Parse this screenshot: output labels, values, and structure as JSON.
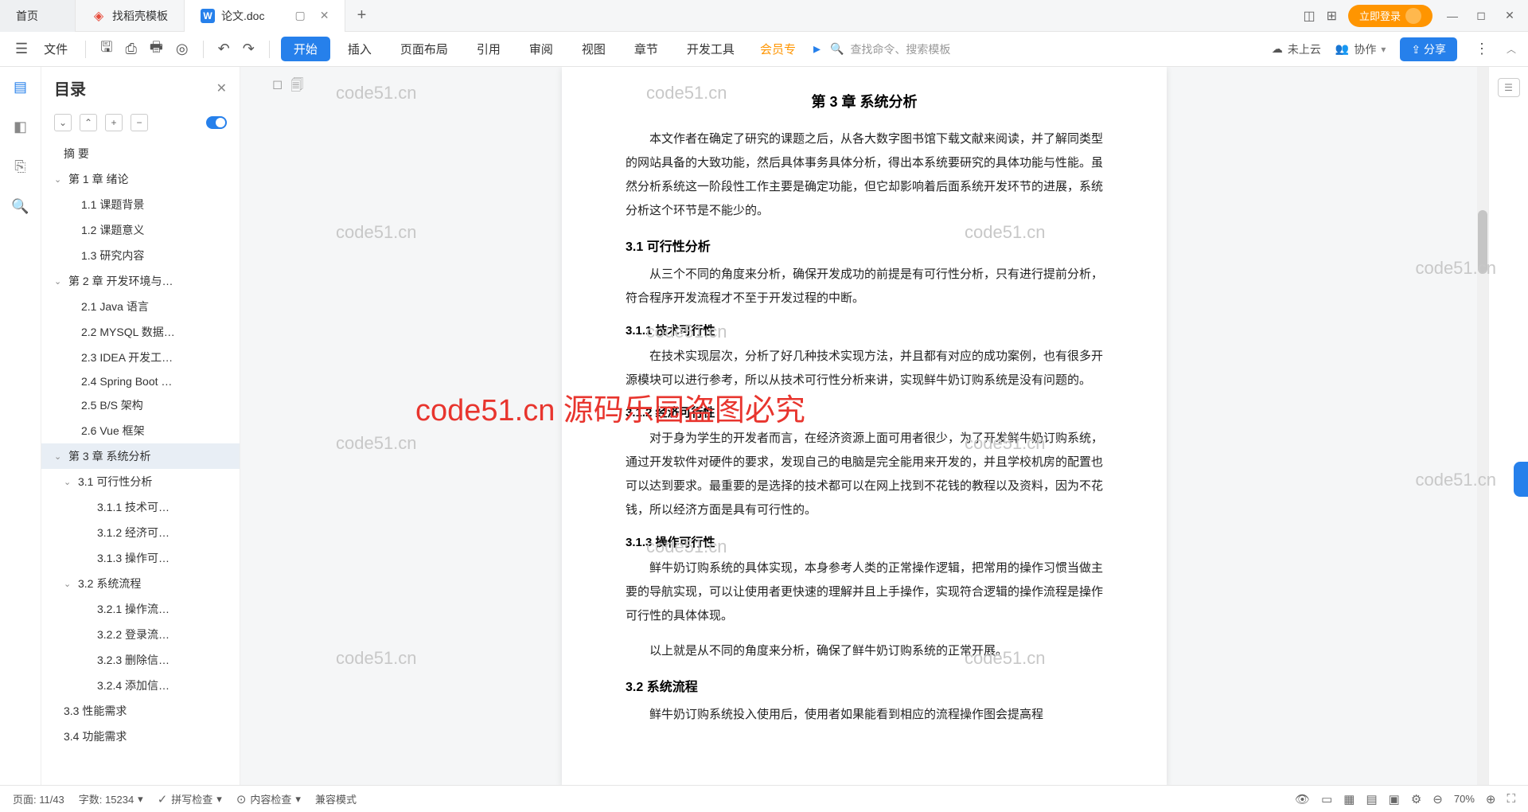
{
  "tabs": {
    "home": "首页",
    "template": "找稻壳模板",
    "doc": "论文.doc"
  },
  "login": "立即登录",
  "file_menu": "文件",
  "menu": [
    "开始",
    "插入",
    "页面布局",
    "引用",
    "审阅",
    "视图",
    "章节",
    "开发工具"
  ],
  "vip": "会员专",
  "search_placeholder": "查找命令、搜索模板",
  "cloud": "未上云",
  "collab": "协作",
  "share": "分享",
  "toc_title": "目录",
  "toc": [
    {
      "lv": 1,
      "t": "摘  要"
    },
    {
      "lv": 0,
      "t": "第 1 章  绪论",
      "a": 1
    },
    {
      "lv": 2,
      "t": "1.1 课题背景"
    },
    {
      "lv": 2,
      "t": "1.2 课题意义"
    },
    {
      "lv": 2,
      "t": "1.3 研究内容"
    },
    {
      "lv": 0,
      "t": "第 2 章  开发环境与…",
      "a": 1
    },
    {
      "lv": 2,
      "t": "2.1 Java 语言"
    },
    {
      "lv": 2,
      "t": "2.2 MYSQL 数据…"
    },
    {
      "lv": 2,
      "t": "2.3 IDEA 开发工…"
    },
    {
      "lv": 2,
      "t": "2.4 Spring Boot …"
    },
    {
      "lv": 2,
      "t": "2.5 B/S 架构"
    },
    {
      "lv": 2,
      "t": "2.6 Vue 框架"
    },
    {
      "lv": 0,
      "t": "第 3 章  系统分析",
      "a": 1,
      "sel": 1
    },
    {
      "lv": 1,
      "t": "3.1  可行性分析",
      "a": 1
    },
    {
      "lv": 3,
      "t": "3.1.1  技术可…"
    },
    {
      "lv": 3,
      "t": "3.1.2  经济可…"
    },
    {
      "lv": 3,
      "t": "3.1.3  操作可…"
    },
    {
      "lv": 1,
      "t": "3.2  系统流程",
      "a": 1
    },
    {
      "lv": 3,
      "t": "3.2.1  操作流…"
    },
    {
      "lv": 3,
      "t": "3.2.2  登录流…"
    },
    {
      "lv": 3,
      "t": "3.2.3  删除信…"
    },
    {
      "lv": 3,
      "t": "3.2.4  添加信…"
    },
    {
      "lv": 1,
      "t": "3.3  性能需求"
    },
    {
      "lv": 1,
      "t": "3.4  功能需求"
    }
  ],
  "doc": {
    "chapter_title": "第 3 章  系统分析",
    "intro": "本文作者在确定了研究的课题之后，从各大数字图书馆下载文献来阅读，并了解同类型的网站具备的大致功能，然后具体事务具体分析，得出本系统要研究的具体功能与性能。虽然分析系统这一阶段性工作主要是确定功能，但它却影响着后面系统开发环节的进展，系统分析这个环节是不能少的。",
    "s31": "3.1  可行性分析",
    "p31": "从三个不同的角度来分析，确保开发成功的前提是有可行性分析，只有进行提前分析，符合程序开发流程才不至于开发过程的中断。",
    "s311": "3.1.1  技术可行性",
    "p311": "在技术实现层次，分析了好几种技术实现方法，并且都有对应的成功案例，也有很多开源模块可以进行参考，所以从技术可行性分析来讲，实现鲜牛奶订购系统是没有问题的。",
    "s312": "3.1.2  经济可行性",
    "p312": "对于身为学生的开发者而言，在经济资源上面可用者很少，为了开发鲜牛奶订购系统，通过开发软件对硬件的要求，发现自己的电脑是完全能用来开发的，并且学校机房的配置也可以达到要求。最重要的是选择的技术都可以在网上找到不花钱的教程以及资料，因为不花钱，所以经济方面是具有可行性的。",
    "s313": "3.1.3  操作可行性",
    "p313a": "鲜牛奶订购系统的具体实现，本身参考人类的正常操作逻辑，把常用的操作习惯当做主要的导航实现，可以让使用者更快速的理解并且上手操作，实现符合逻辑的操作流程是操作可行性的具体体现。",
    "p313b": "以上就是从不同的角度来分析，确保了鲜牛奶订购系统的正常开展。",
    "s32": "3.2  系统流程",
    "p32": "鲜牛奶订购系统投入使用后，使用者如果能看到相应的流程操作图会提高程"
  },
  "wm": "code51.cn",
  "big_wm": "code51.cn   源码乐园盗图必究",
  "status": {
    "page": "页面: 11/43",
    "words": "字数: 15234",
    "spell": "拼写检查",
    "content": "内容检查",
    "compat": "兼容模式",
    "zoom": "70%"
  }
}
